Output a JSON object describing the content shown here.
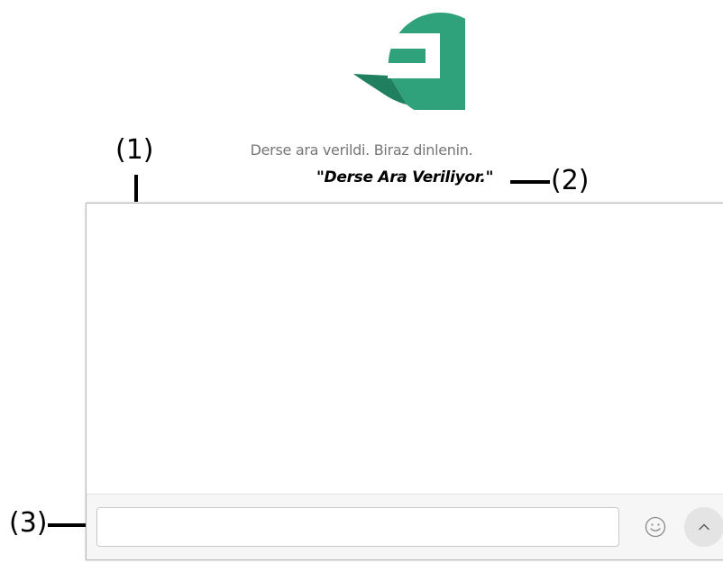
{
  "logo": {
    "icon": "sticker-logo-icon",
    "color": "#2fa27b"
  },
  "status": {
    "message": "Derse ara verildi. Biraz dinlenin.",
    "quote": "\"Derse Ara Veriliyor.\""
  },
  "callouts": {
    "c1": "(1)",
    "c2": "(2)",
    "c3": "(3)"
  },
  "chat": {
    "input_value": "",
    "input_placeholder": "",
    "emoji_icon": "smiley-icon",
    "send_icon": "chevron-up-icon"
  }
}
